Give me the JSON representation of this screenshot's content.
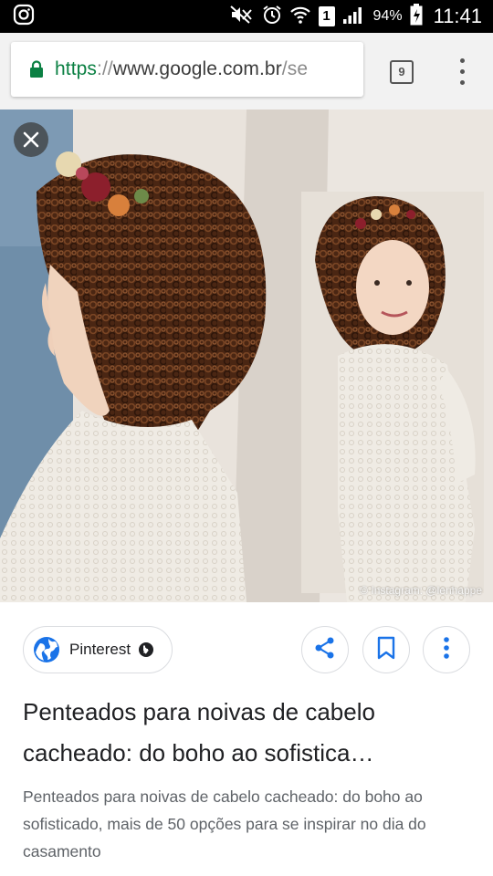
{
  "status_bar": {
    "battery_percent": "94%",
    "time": "11:41",
    "sim_slot": "1",
    "icons": [
      "instagram-icon",
      "mute-icon",
      "alarm-icon",
      "wifi-icon",
      "signal-icon",
      "battery-icon"
    ]
  },
  "browser": {
    "url_scheme": "https",
    "url_separator": "://",
    "url_host": "www.google.com.br",
    "url_rest": "/se",
    "tab_count": "9",
    "accent_color": "#0b8043"
  },
  "image": {
    "watermark": "© Instagram: @lenhappe"
  },
  "result": {
    "source_label": "Pinterest",
    "title": "Penteados para noivas de cabelo cacheado: do boho ao sofistica…",
    "description": "Penteados para noivas de cabelo cacheado: do boho ao sofisticado, mais de 50 opções para se inspirar no dia do casamento",
    "accent_color": "#1a73e8"
  }
}
